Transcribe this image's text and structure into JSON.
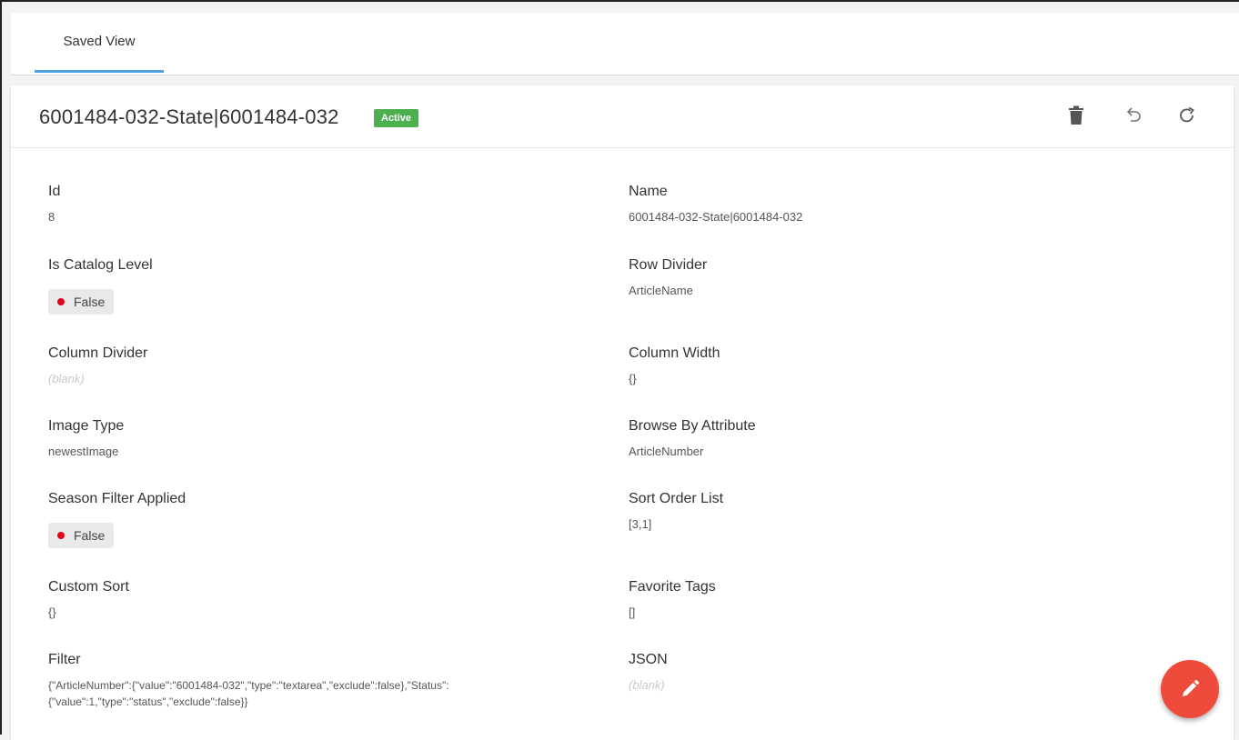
{
  "tabs": [
    {
      "label": "Saved View",
      "active": true
    }
  ],
  "record": {
    "title": "6001484-032-State|6001484-032",
    "status": "Active"
  },
  "header_actions": {
    "delete_icon": "trash-icon",
    "undo_icon": "undo-icon",
    "refresh_icon": "refresh-icon"
  },
  "fields": {
    "id": {
      "label": "Id",
      "value": "8"
    },
    "name": {
      "label": "Name",
      "value": "6001484-032-State|6001484-032"
    },
    "is_catalog_level": {
      "label": "Is Catalog Level",
      "value": "False"
    },
    "row_divider": {
      "label": "Row Divider",
      "value": "ArticleName"
    },
    "column_divider": {
      "label": "Column Divider",
      "value": "(blank)"
    },
    "column_width": {
      "label": "Column Width",
      "value": "{}"
    },
    "image_type": {
      "label": "Image Type",
      "value": "newestImage"
    },
    "browse_by_attribute": {
      "label": "Browse By Attribute",
      "value": "ArticleNumber"
    },
    "season_filter_applied": {
      "label": "Season Filter Applied",
      "value": "False"
    },
    "sort_order_list": {
      "label": "Sort Order List",
      "value": "[3,1]"
    },
    "custom_sort": {
      "label": "Custom Sort",
      "value": "{}"
    },
    "favorite_tags": {
      "label": "Favorite Tags",
      "value": "[]"
    },
    "filter": {
      "label": "Filter",
      "value_line1": "{\"ArticleNumber\":{\"value\":\"6001484-032\",\"type\":\"textarea\",\"exclude\":false},\"Status\":",
      "value_line2": "{\"value\":1,\"type\":\"status\",\"exclude\":false}}"
    },
    "json": {
      "label": "JSON",
      "value": "(blank)"
    }
  },
  "fab": {
    "icon": "pencil-icon"
  },
  "colors": {
    "accent": "#4aa3df",
    "active_badge": "#4caf50",
    "false_dot": "#e3001b",
    "fab": "#ef4b3c"
  }
}
